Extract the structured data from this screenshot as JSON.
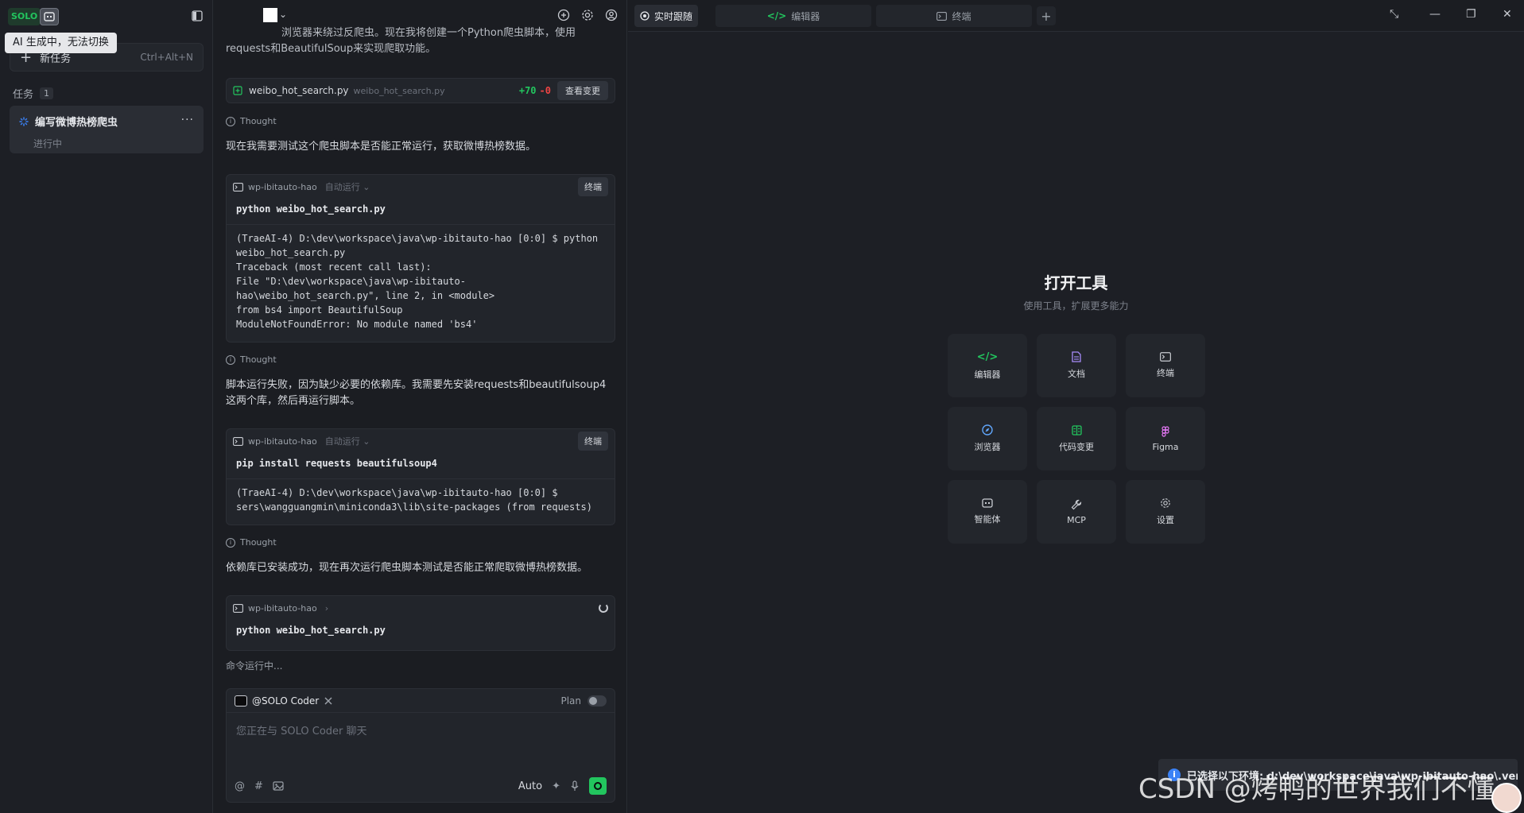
{
  "sidebar": {
    "logo": "SOLO",
    "tooltip": "AI 生成中，无法切换",
    "new_task_label": "新任务",
    "new_task_shortcut": "Ctrl+Alt+N",
    "tasks_label": "任务",
    "tasks_count": "1",
    "task": {
      "title": "编写微博热榜爬虫",
      "status": "进行中"
    }
  },
  "chat": {
    "intro_partial_1": "浏览器来绕过反爬虫。现在我将创建一个Python爬虫脚本，使用",
    "intro_partial_2": "requests和BeautifulSoup来实现爬取功能。",
    "file_change": {
      "name": "weibo_hot_search.py",
      "path": "weibo_hot_search.py",
      "added": "+70",
      "removed": "-0",
      "review_label": "查看变更"
    },
    "thought_label": "Thought",
    "msg1": "现在我需要测试这个爬虫脚本是否能正常运行，获取微博热榜数据。",
    "terminal1": {
      "cwd": "wp-ibitauto-hao",
      "mode": "自动运行",
      "btn": "终端",
      "cmd": "python weibo_hot_search.py",
      "output": "(TraeAI-4) D:\\dev\\workspace\\java\\wp-ibitauto-hao [0:0] $ python\nweibo_hot_search.py\nTraceback (most recent call last):\nFile \"D:\\dev\\workspace\\java\\wp-ibitauto-\nhao\\weibo_hot_search.py\", line 2, in <module>\nfrom bs4 import BeautifulSoup\nModuleNotFoundError: No module named 'bs4'"
    },
    "msg2": "脚本运行失败，因为缺少必要的依赖库。我需要先安装requests和beautifulsoup4这两个库，然后再运行脚本。",
    "terminal2": {
      "cwd": "wp-ibitauto-hao",
      "mode": "自动运行",
      "btn": "终端",
      "cmd": "pip install requests beautifulsoup4",
      "output": "(TraeAI-4) D:\\dev\\workspace\\java\\wp-ibitauto-hao [0:0] $\nsers\\wangguangmin\\miniconda3\\lib\\site-packages (from requests)"
    },
    "msg3": "依赖库已安装成功，现在再次运行爬虫脚本测试是否能正常爬取微博热榜数据。",
    "terminal3": {
      "cwd": "wp-ibitauto-hao",
      "cmd": "python weibo_hot_search.py"
    },
    "running": "命令运行中...",
    "composer": {
      "agent": "@SOLO Coder",
      "plan": "Plan",
      "placeholder": "您正在与 SOLO Coder 聊天",
      "auto": "Auto"
    }
  },
  "right": {
    "tabs": [
      "实时跟随",
      "编辑器",
      "终端"
    ],
    "title": "打开工具",
    "subtitle": "使用工具，扩展更多能力",
    "tools": [
      {
        "label": "编辑器",
        "icon": "code-icon",
        "color": "#22c55e"
      },
      {
        "label": "文档",
        "icon": "document-icon",
        "color": "#a78bfa"
      },
      {
        "label": "终端",
        "icon": "terminal-icon",
        "color": "#c9ccd2"
      },
      {
        "label": "浏览器",
        "icon": "compass-icon",
        "color": "#60a5fa"
      },
      {
        "label": "代码变更",
        "icon": "diff-icon",
        "color": "#22c55e"
      },
      {
        "label": "Figma",
        "icon": "figma-icon",
        "color": "#e879f9"
      },
      {
        "label": "智能体",
        "icon": "agent-icon",
        "color": "#c9ccd2"
      },
      {
        "label": "MCP",
        "icon": "wrench-icon",
        "color": "#c9ccd2"
      },
      {
        "label": "设置",
        "icon": "gear-icon",
        "color": "#c9ccd2"
      }
    ],
    "toast": "已选择以下环境: d:\\dev\\workspace\\java\\wp-ibitauto-hao\\.venv",
    "watermark": "CSDN @烤鸭的世界我们不懂"
  }
}
